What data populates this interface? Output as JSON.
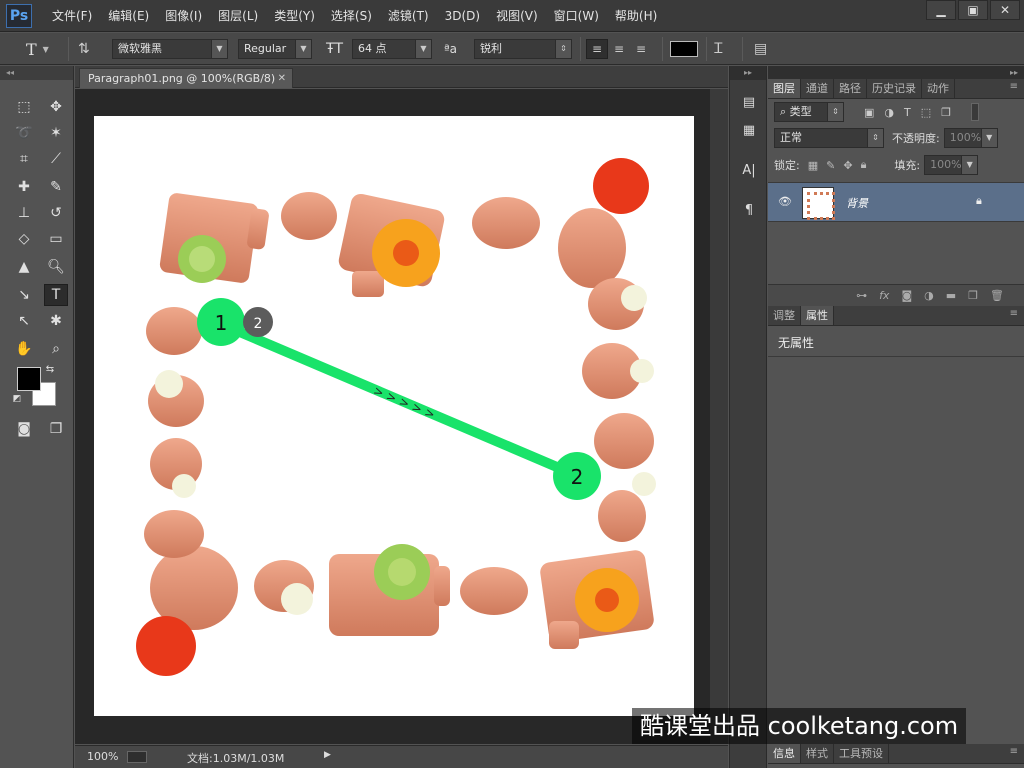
{
  "app": {
    "logo": "Ps",
    "menu": [
      "文件(F)",
      "编辑(E)",
      "图像(I)",
      "图层(L)",
      "类型(Y)",
      "选择(S)",
      "滤镜(T)",
      "3D(D)",
      "视图(V)",
      "窗口(W)",
      "帮助(H)"
    ]
  },
  "options": {
    "tool_icon": "T",
    "font_family": "微软雅黑",
    "font_style": "Regular",
    "font_size": "64 点",
    "aa_icon_text": "ªa",
    "anti_alias": "锐利",
    "text_color": "#000000"
  },
  "document": {
    "tab_title": "Paragraph01.png @ 100%(RGB/8)",
    "zoom": "100%",
    "doc_info": "文档:1.03M/1.03M"
  },
  "annotation": {
    "start_label": "1",
    "end_label": "2",
    "step_badge": "2",
    "arrows": "> > > > >",
    "color": "#19e36a"
  },
  "layers_panel": {
    "tabs": [
      "图层",
      "通道",
      "路径",
      "历史记录",
      "动作"
    ],
    "filter_kind": "类型",
    "blend_mode": "正常",
    "opacity_label": "不透明度:",
    "opacity_value": "100%",
    "lock_label": "锁定:",
    "fill_label": "填充:",
    "fill_value": "100%",
    "layer_name": "背景"
  },
  "properties_panel": {
    "tabs": [
      "调整",
      "属性"
    ],
    "content": "无属性"
  },
  "bottom_panel": {
    "tabs": [
      "信息",
      "样式",
      "工具预设"
    ]
  },
  "watermark": "酷课堂出品 coolketang.com"
}
